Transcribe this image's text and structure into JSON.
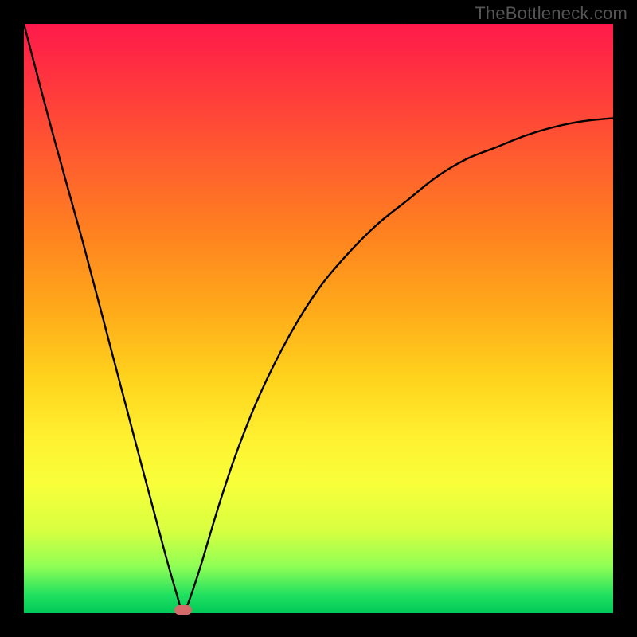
{
  "watermark": "TheBottleneck.com",
  "chart_data": {
    "type": "line",
    "title": "",
    "xlabel": "",
    "ylabel": "",
    "xlim": [
      0,
      100
    ],
    "ylim": [
      0,
      100
    ],
    "grid": false,
    "legend": false,
    "series": [
      {
        "name": "bottleneck-curve",
        "x": [
          0,
          5,
          10,
          15,
          20,
          24,
          26,
          27,
          28,
          30,
          33,
          36,
          40,
          45,
          50,
          55,
          60,
          65,
          70,
          75,
          80,
          85,
          90,
          95,
          100
        ],
        "y": [
          100,
          81,
          63,
          44,
          25,
          10,
          3,
          0,
          2,
          8,
          18,
          27,
          37,
          47,
          55,
          61,
          66,
          70,
          74,
          77,
          79,
          81,
          82.5,
          83.5,
          84
        ]
      }
    ],
    "annotations": [
      {
        "name": "minimum-marker",
        "x": 27,
        "y": 0.5
      }
    ],
    "gradient_stops": [
      {
        "pos": 0.0,
        "color": "#ff1a4b"
      },
      {
        "pos": 0.5,
        "color": "#ffc020"
      },
      {
        "pos": 0.8,
        "color": "#f6ff40"
      },
      {
        "pos": 1.0,
        "color": "#00c858"
      }
    ]
  }
}
